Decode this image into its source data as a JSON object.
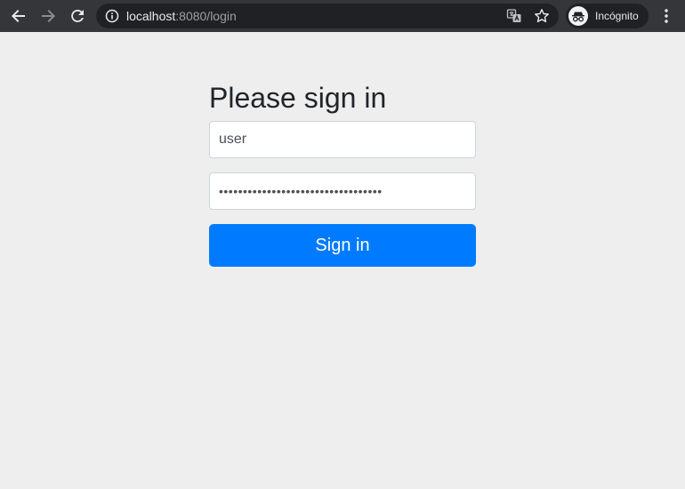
{
  "browser": {
    "url_host": "localhost",
    "url_rest": ":8080/login",
    "profile_label": "Incógnito",
    "colors": {
      "toolbar": "#35363a",
      "omnibox": "#202124"
    },
    "icons": [
      "back-arrow-icon",
      "forward-arrow-icon",
      "reload-icon",
      "info-icon",
      "translate-icon",
      "star-icon",
      "incognito-icon",
      "kebab-menu-icon"
    ]
  },
  "login": {
    "title": "Please sign in",
    "username_value": "user",
    "password_masked": "••••••••••••••••••••••••••••••••••",
    "submit_label": "Sign in",
    "colors": {
      "primary": "#007bff",
      "background": "#eeeeee"
    }
  }
}
